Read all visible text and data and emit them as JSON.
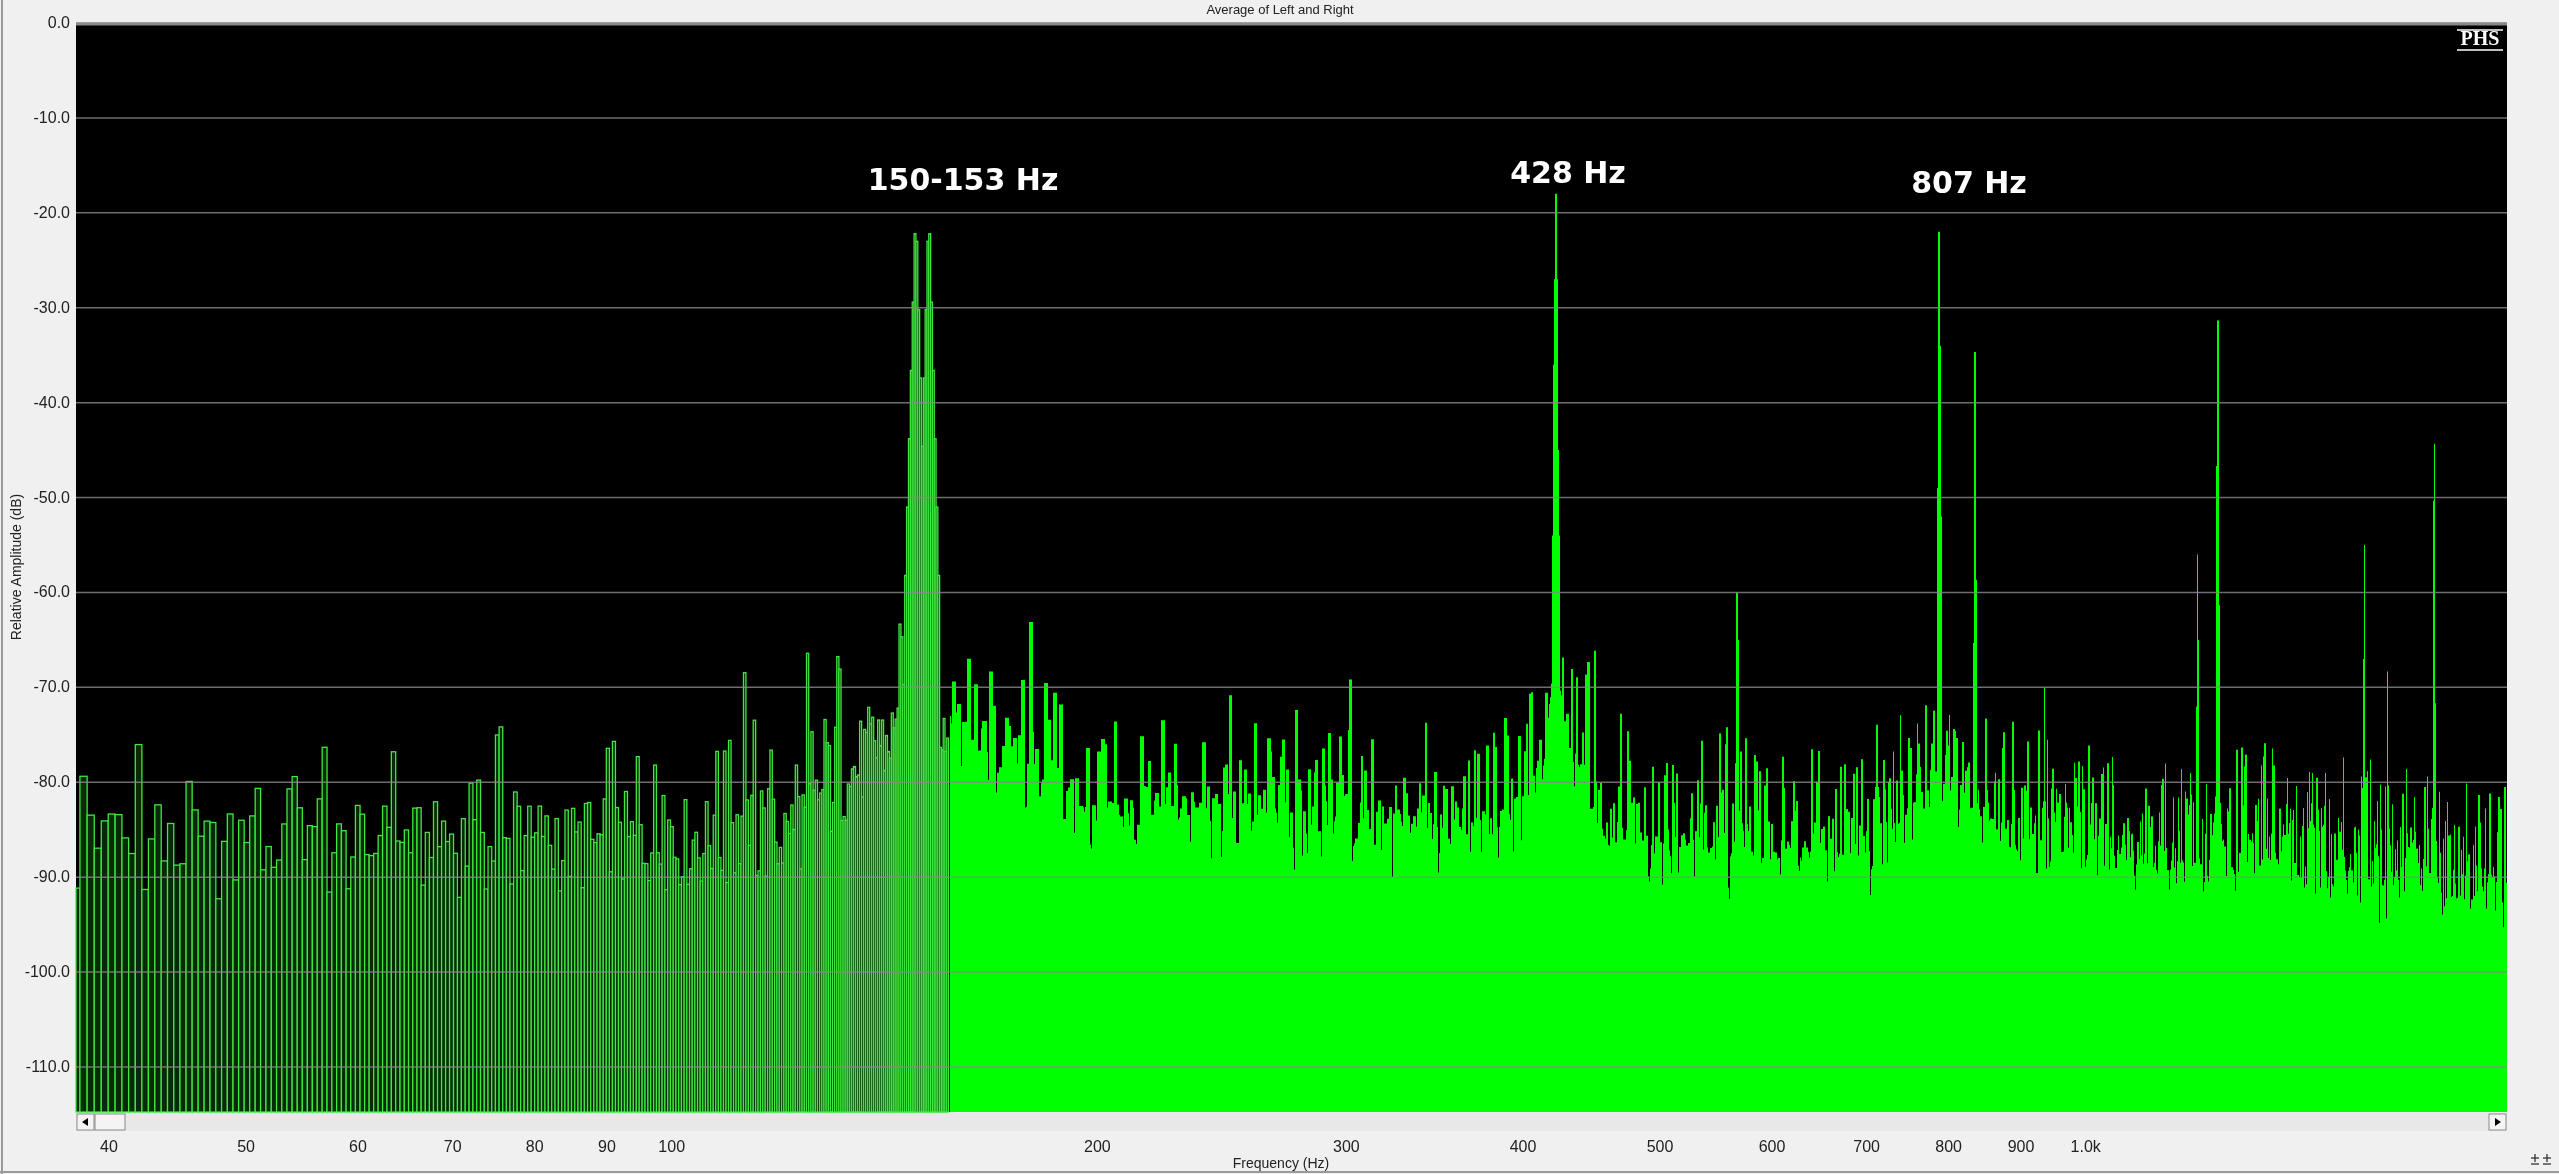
{
  "title": "Average of Left and Right",
  "logo": "PHS",
  "y_axis": {
    "label": "Relative Amplitude (dB)",
    "ticks": [
      "0.0",
      "-10.0",
      "-20.0",
      "-30.0",
      "-40.0",
      "-50.0",
      "-60.0",
      "-70.0",
      "-80.0",
      "-90.0",
      "-100.0",
      "-110.0"
    ]
  },
  "x_axis": {
    "label": "Frequency (Hz)",
    "ticks": [
      "40",
      "50",
      "60",
      "70",
      "80",
      "90",
      "100",
      "200",
      "300",
      "400",
      "500",
      "600",
      "700",
      "800",
      "900",
      "1.0k"
    ]
  },
  "peak_labels": [
    "150-153 Hz",
    "428 Hz",
    "807 Hz"
  ]
}
